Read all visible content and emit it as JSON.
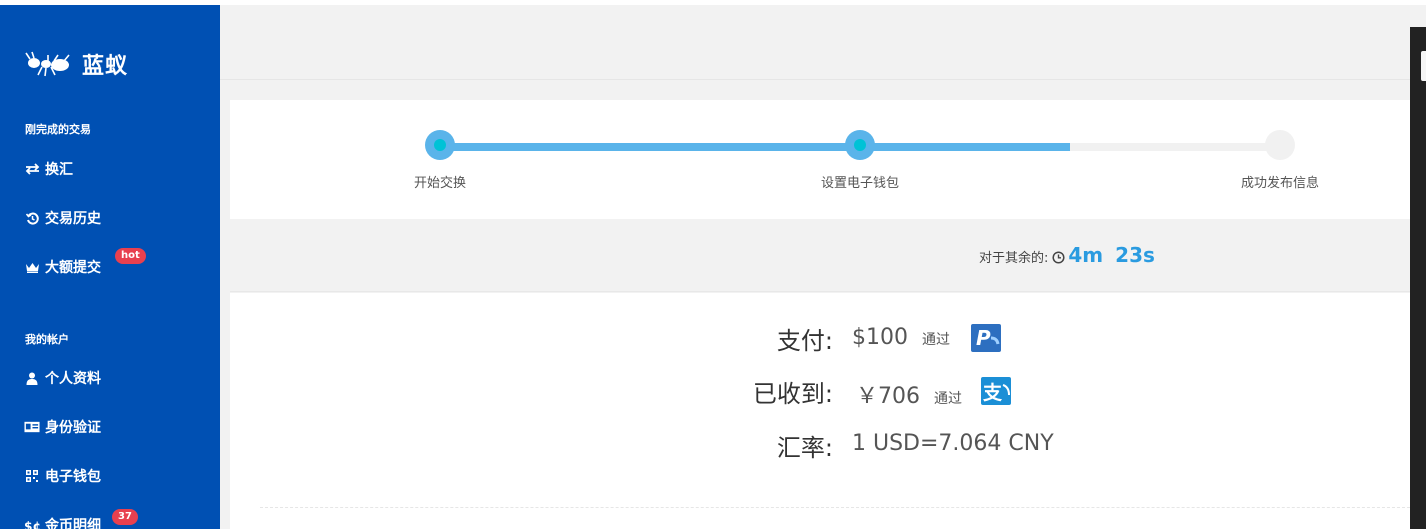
{
  "sidebar": {
    "brand": "蓝蚁",
    "sections": [
      {
        "label": "刚完成的交易",
        "items": [
          {
            "label": "换汇",
            "icon": "exchange-arrows-icon"
          },
          {
            "label": "交易历史",
            "icon": "history-icon"
          },
          {
            "label": "大额提交",
            "icon": "crown-icon",
            "badge": "hot"
          }
        ]
      },
      {
        "label": "我的帐户",
        "items": [
          {
            "label": "个人资料",
            "icon": "user-icon"
          },
          {
            "label": "身份验证",
            "icon": "id-card-icon"
          },
          {
            "label": "电子钱包",
            "icon": "qrcode-icon"
          },
          {
            "label": "金币明细",
            "icon": "coins-icon",
            "badge": "37"
          }
        ]
      }
    ]
  },
  "steps": {
    "items": [
      "开始交换",
      "设置电子钱包",
      "成功发布信息"
    ],
    "completed": 2,
    "total": 3
  },
  "timer": {
    "label": "对于其余的:",
    "minutes": "4m",
    "seconds": "23s"
  },
  "details": {
    "pay_label": "支付:",
    "pay_value": "$100",
    "pay_via": "通过",
    "pay_method_icon": "paypal-icon",
    "receive_label": "已收到:",
    "receive_value": "￥706",
    "receive_via": "通过",
    "receive_method_icon": "alipay-icon",
    "rate_label": "汇率:",
    "rate_value": "1 USD=7.064 CNY"
  },
  "colors": {
    "sidebar_bg": "#0050b3",
    "accent": "#5ab4ea",
    "dot_center": "#00c2d6",
    "timer_blue": "#2a9be0",
    "badge_red": "#e8404f"
  }
}
